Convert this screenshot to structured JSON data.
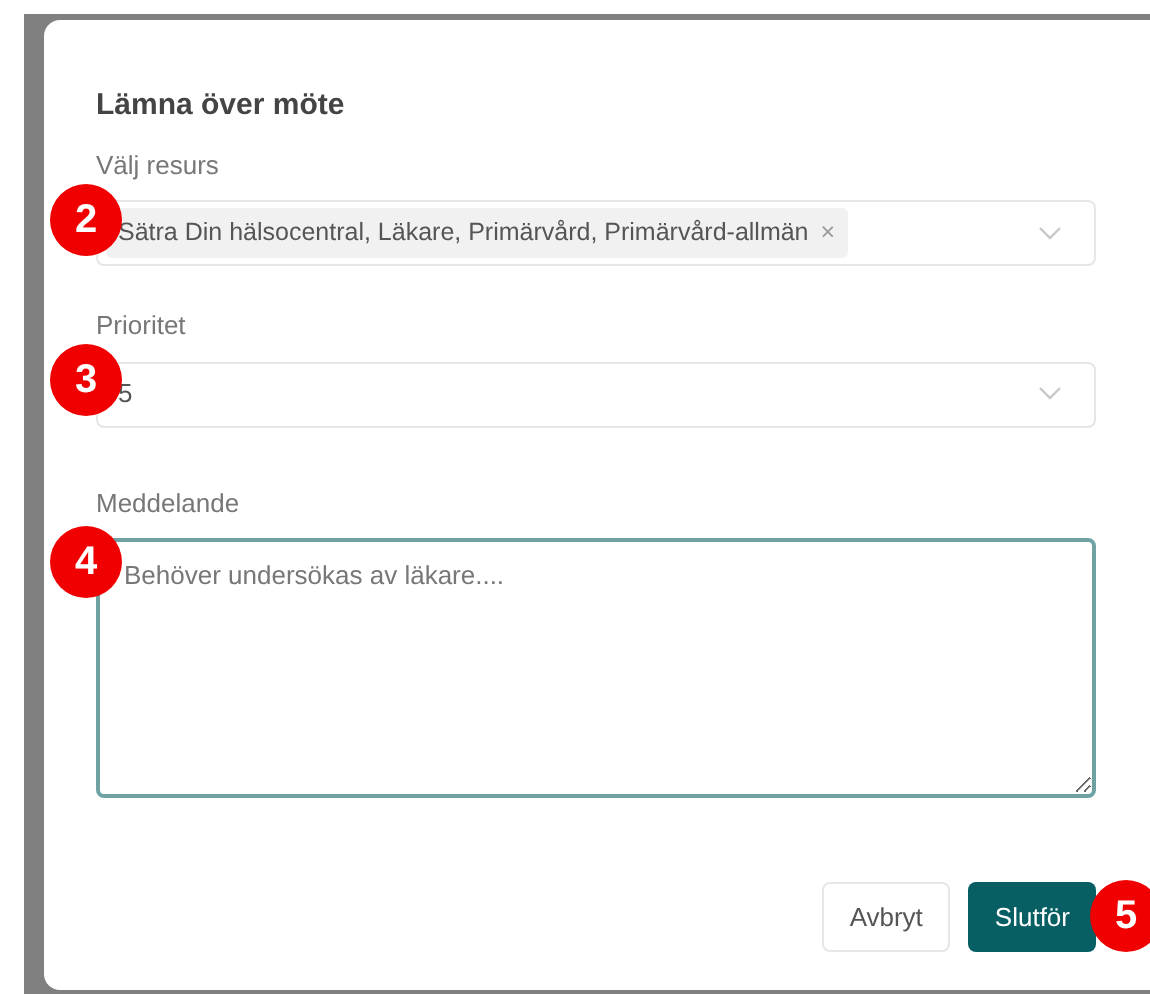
{
  "dialog": {
    "title": "Lämna över möte",
    "fields": [
      {
        "kind": "select",
        "label": "Välj resurs",
        "chip": "Sätra Din hälsocentral, Läkare, Primärvård, Primärvård-allmän",
        "chip_remove": "×",
        "marker": "2"
      },
      {
        "kind": "select",
        "label": "Prioritet",
        "value": "5",
        "marker": "3"
      },
      {
        "kind": "textarea",
        "label": "Meddelande",
        "placeholder": "Behöver undersökas av läkare....",
        "focused": true,
        "marker": "4"
      }
    ],
    "buttons": [
      {
        "label": "Avbryt",
        "primary": false
      },
      {
        "label": "Slutför",
        "primary": true,
        "marker": "5"
      }
    ]
  }
}
